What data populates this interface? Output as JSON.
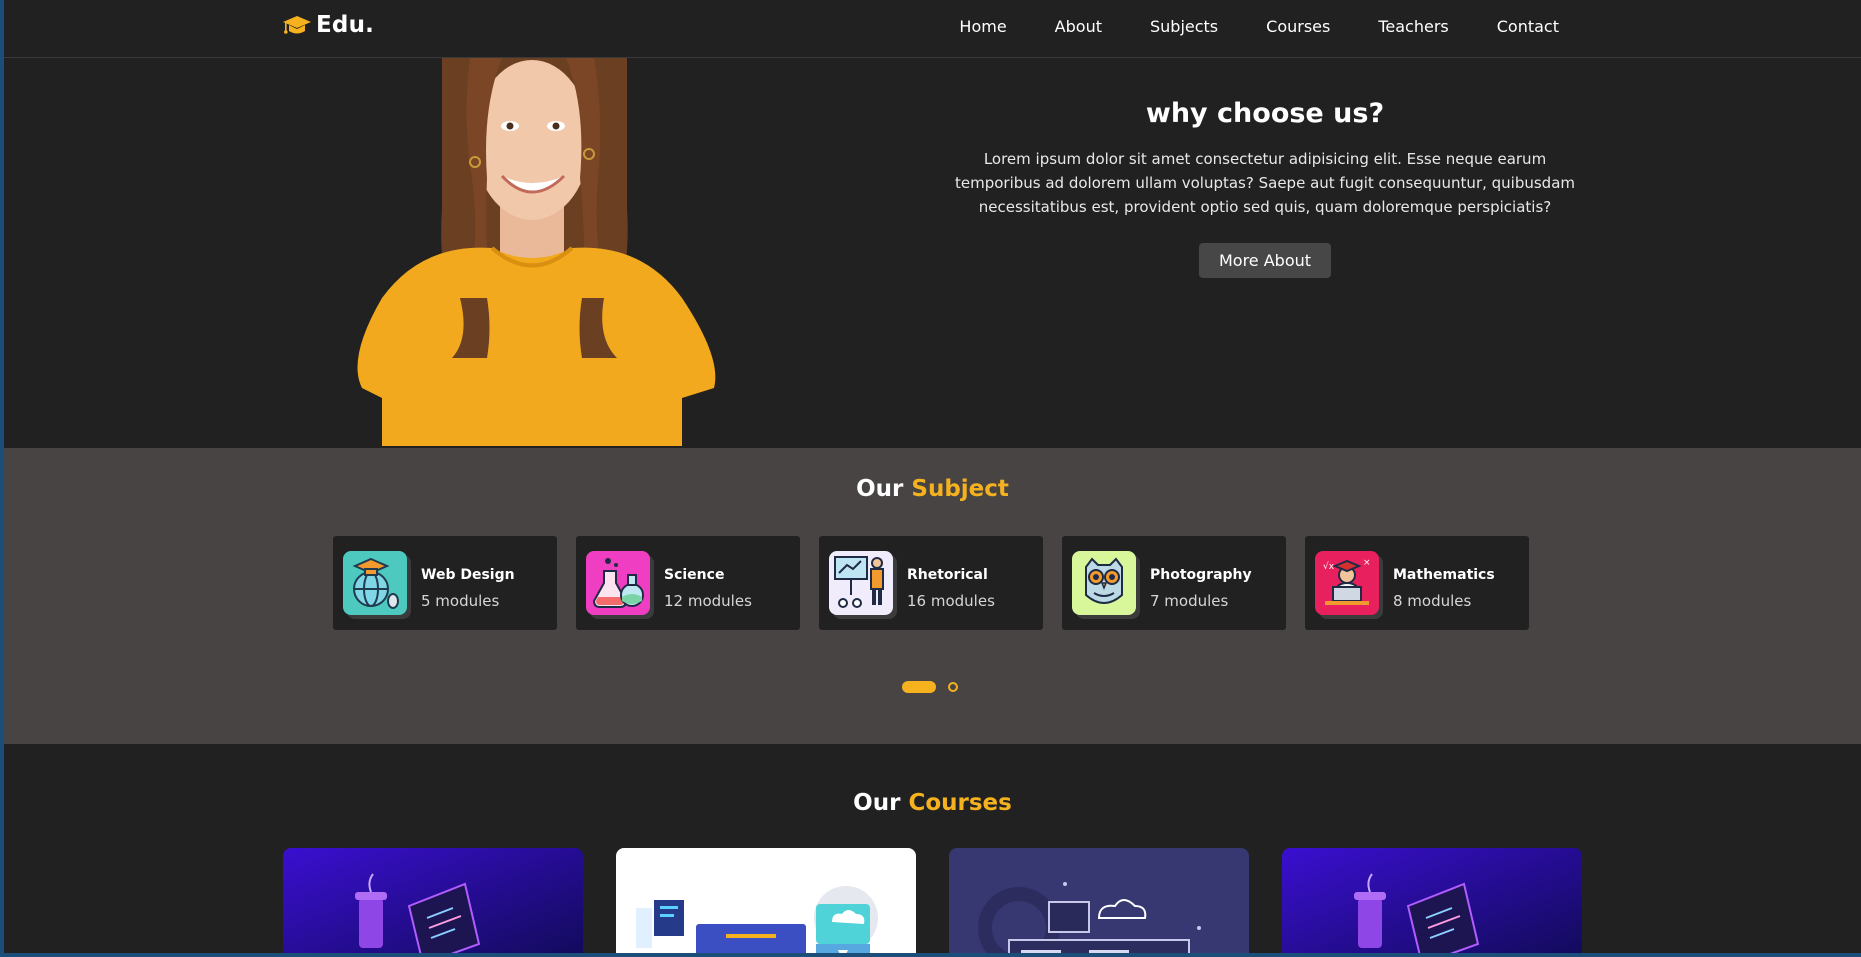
{
  "nav": {
    "logo_text": "Edu.",
    "items": [
      "Home",
      "About",
      "Subjects",
      "Courses",
      "Teachers",
      "Contact"
    ]
  },
  "hero": {
    "title": "why choose us?",
    "text": "Lorem ipsum dolor sit amet consectetur adipisicing elit. Esse neque earum temporibus ad dolorem ullam voluptas? Saepe aut fugit consequuntur, quibusdam necessitatibus est, provident optio sed quis, quam doloremque perspiciatis?",
    "button": "More About"
  },
  "subjects": {
    "title_prefix": "Our",
    "title_highlight": "Subject",
    "cards": [
      {
        "title": "Web Design",
        "modules": "5 modules",
        "icon": "globe-graduation-icon",
        "color": "#4ec9c0"
      },
      {
        "title": "Science",
        "modules": "12 modules",
        "icon": "flask-icon",
        "color": "#f03ec2"
      },
      {
        "title": "Rhetorical",
        "modules": "16 modules",
        "icon": "presentation-icon",
        "color": "#f1ecfb"
      },
      {
        "title": "Photography",
        "modules": "7 modules",
        "icon": "owl-icon",
        "color": "#d8f79a"
      },
      {
        "title": "Mathematics",
        "modules": "8 modules",
        "icon": "student-laptop-icon",
        "color": "#e8205e"
      }
    ],
    "carousel_pages": 2,
    "carousel_active": 1
  },
  "courses": {
    "title_prefix": "Our",
    "title_highlight": "Courses",
    "thumbnails": [
      "coding-desk-illustration",
      "web-development-illustration",
      "cloud-settings-illustration",
      "coding-desk-illustration"
    ]
  },
  "colors": {
    "accent": "#f5b21e",
    "dark_bg": "#212121",
    "subjects_bg": "#474443",
    "button_bg": "#474747"
  }
}
